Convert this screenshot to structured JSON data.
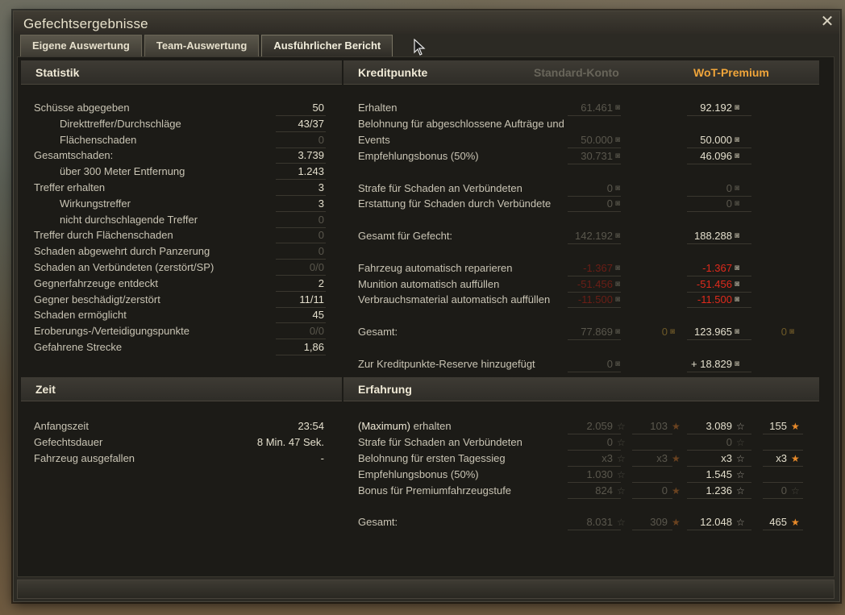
{
  "window": {
    "title": "Gefechtsergebnisse"
  },
  "tabs": [
    "Eigene Auswertung",
    "Team-Auswertung",
    "Ausführlicher Bericht"
  ],
  "active_tab": 2,
  "statistik": {
    "title": "Statistik",
    "rows": [
      {
        "label": "Schüsse abgegeben",
        "value": "50",
        "indent": false,
        "dim": false
      },
      {
        "label": "Direkttreffer/Durchschläge",
        "value": "43/37",
        "indent": true,
        "dim": false
      },
      {
        "label": "Flächenschaden",
        "value": "0",
        "indent": true,
        "dim": true
      },
      {
        "label": "Gesamtschaden:",
        "value": "3.739",
        "indent": false,
        "dim": false
      },
      {
        "label": "über 300 Meter Entfernung",
        "value": "1.243",
        "indent": true,
        "dim": false
      },
      {
        "label": "Treffer erhalten",
        "value": "3",
        "indent": false,
        "dim": false
      },
      {
        "label": "Wirkungstreffer",
        "value": "3",
        "indent": true,
        "dim": false
      },
      {
        "label": "nicht durchschlagende Treffer",
        "value": "0",
        "indent": true,
        "dim": true
      },
      {
        "label": "Treffer durch Flächenschaden",
        "value": "0",
        "indent": false,
        "dim": true
      },
      {
        "label": "Schaden abgewehrt durch Panzerung",
        "value": "0",
        "indent": false,
        "dim": true
      },
      {
        "label": "Schaden an Verbündeten (zerstört/SP)",
        "value": "0/0",
        "indent": false,
        "dim": true
      },
      {
        "label": "Gegnerfahrzeuge entdeckt",
        "value": "2",
        "indent": false,
        "dim": false
      },
      {
        "label": "Gegner beschädigt/zerstört",
        "value": "11/11",
        "indent": false,
        "dim": false
      },
      {
        "label": "Schaden ermöglicht",
        "value": "45",
        "indent": false,
        "dim": false
      },
      {
        "label": "Eroberungs-/Verteidigungspunkte",
        "value": "0/0",
        "indent": false,
        "dim": true
      },
      {
        "label": "Gefahrene Strecke",
        "value": "1,86",
        "indent": false,
        "dim": false
      }
    ]
  },
  "zeit": {
    "title": "Zeit",
    "rows": [
      {
        "label": "Anfangszeit",
        "value": "23:54"
      },
      {
        "label": "Gefechtsdauer",
        "value": "8 Min. 47 Sek."
      },
      {
        "label": "Fahrzeug ausgefallen",
        "value": "-"
      }
    ]
  },
  "kredit": {
    "title": "Kreditpunkte",
    "col_standard": "Standard-Konto",
    "col_premium": "WoT-Premium",
    "rows": [
      {
        "label": "Erhalten",
        "std": "61.461",
        "prem": "92.192",
        "style": "normal"
      },
      {
        "label": "Belohnung für abgeschlossene Aufträge und",
        "std": "",
        "prem": "",
        "style": "label"
      },
      {
        "label": "Events",
        "std": "50.000",
        "prem": "50.000",
        "style": "normal"
      },
      {
        "label": "Empfehlungsbonus (50%)",
        "std": "30.731",
        "prem": "46.096",
        "style": "normal"
      },
      {
        "label": "Strafe für Schaden an Verbündeten",
        "std": "0",
        "prem": "0",
        "style": "zero"
      },
      {
        "label": "Erstattung für Schaden durch Verbündete",
        "std": "0",
        "prem": "0",
        "style": "zero"
      },
      {
        "label": "Gesamt für Gefecht:",
        "std": "142.192",
        "prem": "188.288",
        "style": "normal"
      },
      {
        "label": "Fahrzeug automatisch reparieren",
        "std": "-1.367",
        "prem": "-1.367",
        "style": "red"
      },
      {
        "label": "Munition automatisch auffüllen",
        "std": "-51.456",
        "prem": "-51.456",
        "style": "red"
      },
      {
        "label": "Verbrauchsmaterial automatisch auffüllen",
        "std": "-11.500",
        "prem": "-11.500",
        "style": "red"
      },
      {
        "label": "Gesamt:",
        "std": "77.869",
        "std_gold": "0",
        "prem": "123.965",
        "prem_gold": "0",
        "style": "total"
      },
      {
        "label": "Zur Kreditpunkte-Reserve hinzugefügt",
        "std": "0",
        "prem": "+ 18.829",
        "style": "reserve"
      }
    ]
  },
  "erfahrung": {
    "title": "Erfahrung",
    "rows": [
      {
        "label": "erhalten",
        "label_prefix": "(Maximum)",
        "std": "2.059",
        "std_free": "103",
        "prem": "3.089",
        "prem_free": "155"
      },
      {
        "label": "Strafe für Schaden an Verbündeten",
        "std": "0",
        "std_free": "",
        "prem": "0",
        "prem_free": ""
      },
      {
        "label": "Belohnung für ersten Tagessieg",
        "std": "x3",
        "std_free": "x3",
        "prem": "x3",
        "prem_free": "x3"
      },
      {
        "label": "Empfehlungsbonus (50%)",
        "std": "1.030",
        "std_free": "",
        "prem": "1.545",
        "prem_free": ""
      },
      {
        "label": "Bonus für Premiumfahrzeugstufe",
        "std": "824",
        "std_free": "0",
        "prem": "1.236",
        "prem_free": "0"
      },
      {
        "label": "Gesamt:",
        "std": "8.031",
        "std_free": "309",
        "prem": "12.048",
        "prem_free": "465"
      }
    ]
  },
  "icons": {
    "credit": "credit-icon",
    "gold": "gold-icon",
    "xp": "xp-star-icon",
    "free_xp": "free-xp-star-icon",
    "close": "close-icon"
  }
}
